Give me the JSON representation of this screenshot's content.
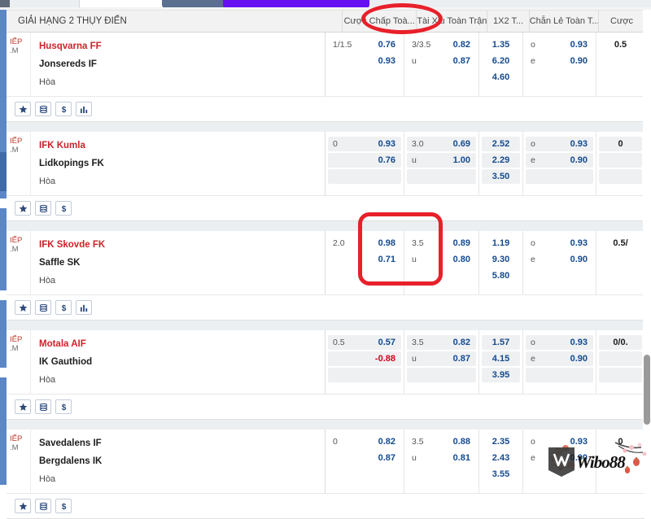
{
  "toolbar": {
    "input_placeholder": "",
    "input_value": "",
    "slate_button_label": "",
    "purple_button_label": ""
  },
  "header": {
    "league_title": "GIẢI HẠNG 2 THỤY ĐIỂN",
    "columns": [
      {
        "label": "Cược Chấp Toà...",
        "key": "handicap"
      },
      {
        "label": "Tài Xỉu Toàn Trận",
        "key": "over_under"
      },
      {
        "label": "1X2 T...",
        "key": "one_x_two"
      },
      {
        "label": "Chẵn Lẻ Toàn T...",
        "key": "odd_even"
      },
      {
        "label": "Cược",
        "key": "last"
      }
    ]
  },
  "live_label": {
    "line1": "IẾP",
    "line2": ".M"
  },
  "draw_label": "Hòa",
  "icons": {
    "star": "star-icon",
    "list": "list-icon",
    "dollar": "dollar-icon",
    "chart": "bar-chart-icon"
  },
  "colors": {
    "home_team": "#cc2229",
    "away_team": "#1d1d1d",
    "odds": "#134a8e",
    "negative_odds": "#d0021b",
    "annotation": "#e8202a",
    "rail": "#5b87c5",
    "purple_button": "#6610f2",
    "slate_button": "#5b7090"
  },
  "matches": [
    {
      "home": "Husqvarna FF",
      "away": "Jonsereds IF",
      "shaded": false,
      "handicap": [
        {
          "hc": "1/1.5",
          "odd": "0.76"
        },
        {
          "hc": "",
          "odd": "0.93"
        }
      ],
      "over_under": [
        {
          "hc": "3/3.5",
          "odd": "0.82"
        },
        {
          "hc": "u",
          "odd": "0.87"
        }
      ],
      "one_x_two": [
        "1.35",
        "6.20",
        "4.60"
      ],
      "odd_even": [
        {
          "hc": "o",
          "odd": "0.93"
        },
        {
          "hc": "e",
          "odd": "0.90"
        }
      ],
      "last": "0.5",
      "icons": [
        "star",
        "list",
        "dollar",
        "chart"
      ]
    },
    {
      "home": "IFK Kumla",
      "away": "Lidkopings FK",
      "shaded": true,
      "handicap": [
        {
          "hc": "0",
          "odd": "0.93"
        },
        {
          "hc": "",
          "odd": "0.76"
        }
      ],
      "over_under": [
        {
          "hc": "3.0",
          "odd": "0.69"
        },
        {
          "hc": "u",
          "odd": "1.00"
        }
      ],
      "one_x_two": [
        "2.52",
        "2.29",
        "3.50"
      ],
      "odd_even": [
        {
          "hc": "o",
          "odd": "0.93"
        },
        {
          "hc": "e",
          "odd": "0.90"
        }
      ],
      "last": "0",
      "icons": [
        "star",
        "list",
        "dollar"
      ]
    },
    {
      "home": "IFK Skovde FK",
      "away": "Saffle SK",
      "shaded": false,
      "handicap": [
        {
          "hc": "2.0",
          "odd": "0.98"
        },
        {
          "hc": "",
          "odd": "0.71"
        }
      ],
      "over_under": [
        {
          "hc": "3.5",
          "odd": "0.89"
        },
        {
          "hc": "u",
          "odd": "0.80"
        }
      ],
      "one_x_two": [
        "1.19",
        "9.30",
        "5.80"
      ],
      "odd_even": [
        {
          "hc": "o",
          "odd": "0.93"
        },
        {
          "hc": "e",
          "odd": "0.90"
        }
      ],
      "last": "0.5/",
      "icons": [
        "star",
        "list",
        "dollar",
        "chart"
      ]
    },
    {
      "home": "Motala AIF",
      "away": "IK Gauthiod",
      "shaded": true,
      "handicap": [
        {
          "hc": "0.5",
          "odd": "0.57"
        },
        {
          "hc": "",
          "odd": "-0.88",
          "negative": true
        }
      ],
      "over_under": [
        {
          "hc": "3.5",
          "odd": "0.82"
        },
        {
          "hc": "u",
          "odd": "0.87"
        }
      ],
      "one_x_two": [
        "1.57",
        "4.15",
        "3.95"
      ],
      "odd_even": [
        {
          "hc": "o",
          "odd": "0.93"
        },
        {
          "hc": "e",
          "odd": "0.90"
        }
      ],
      "last": "0/0.",
      "icons": [
        "star",
        "list",
        "dollar"
      ]
    },
    {
      "home": "Savedalens IF",
      "away": "Bergdalens IK",
      "shaded": false,
      "home_is_red": false,
      "handicap": [
        {
          "hc": "0",
          "odd": "0.82"
        },
        {
          "hc": "",
          "odd": "0.87"
        }
      ],
      "over_under": [
        {
          "hc": "3.5",
          "odd": "0.88"
        },
        {
          "hc": "u",
          "odd": "0.81"
        }
      ],
      "one_x_two": [
        "2.35",
        "2.43",
        "3.55"
      ],
      "odd_even": [
        {
          "hc": "o",
          "odd": "0.93"
        },
        {
          "hc": "e",
          "odd": "0.90"
        }
      ],
      "last": "0",
      "icons": [
        "star",
        "list",
        "dollar"
      ]
    }
  ],
  "watermark": {
    "text": "Wibo88"
  }
}
